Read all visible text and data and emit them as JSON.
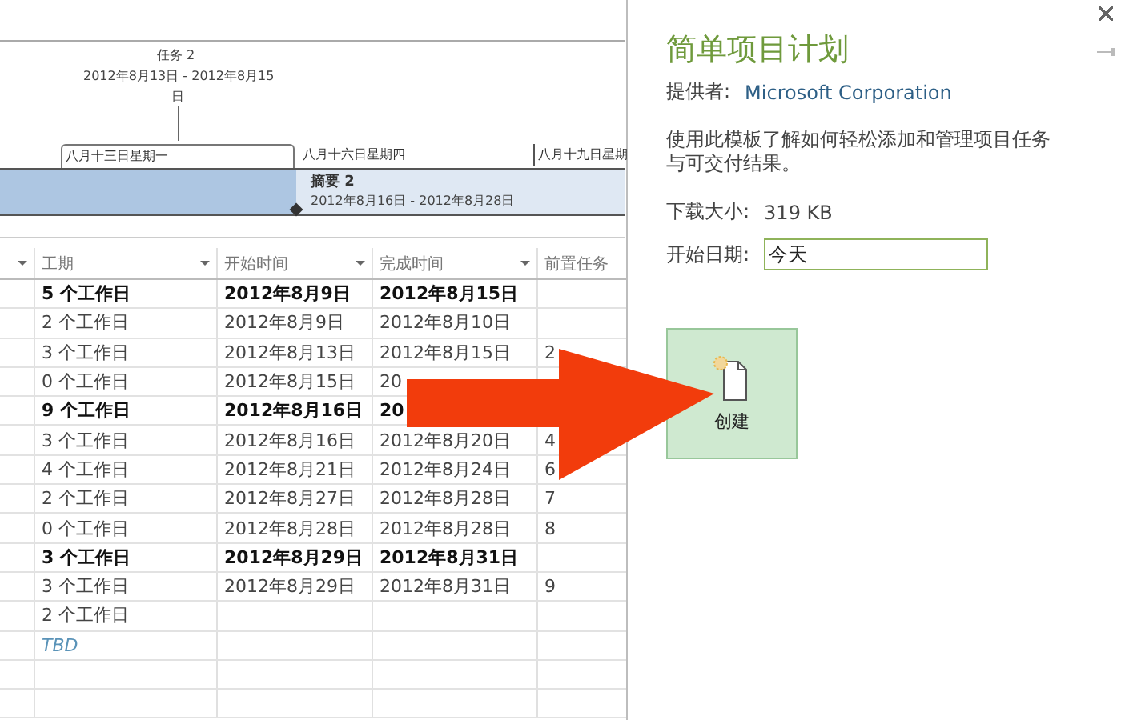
{
  "timeline": {
    "milestone": {
      "name": "任务 2",
      "dates": "2012年8月13日 - 2012年8月15",
      "dates_tail": "日"
    },
    "scale": [
      {
        "label": "八月十三日星期一",
        "kind": "bracket"
      },
      {
        "label": "八月十六日星期四",
        "kind": "plain"
      },
      {
        "label": "八月十九日星期",
        "kind": "tick"
      }
    ],
    "summary": {
      "name": "摘要 2",
      "dates": "2012年8月16日 - 2012年8月28日"
    }
  },
  "table": {
    "columns": [
      "工期",
      "开始时间",
      "完成时间",
      "前置任务"
    ],
    "rows": [
      {
        "kind": "summary",
        "cells": [
          "5 个工作日",
          "2012年8月9日",
          "2012年8月15日"
        ]
      },
      {
        "kind": "task",
        "cells": [
          "2 个工作日",
          "2012年8月9日",
          "2012年8月10日"
        ]
      },
      {
        "kind": "task",
        "cells": [
          "3 个工作日",
          "2012年8月13日",
          "2012年8月15日",
          "2"
        ]
      },
      {
        "kind": "task",
        "cells": [
          "0 个工作日",
          "2012年8月15日",
          "20"
        ]
      },
      {
        "kind": "summary",
        "cells": [
          "9 个工作日",
          "2012年8月16日",
          "20"
        ]
      },
      {
        "kind": "task",
        "cells": [
          "3 个工作日",
          "2012年8月16日",
          "2012年8月20日",
          "4"
        ]
      },
      {
        "kind": "task",
        "cells": [
          "4 个工作日",
          "2012年8月21日",
          "2012年8月24日",
          "6"
        ]
      },
      {
        "kind": "task",
        "cells": [
          "2 个工作日",
          "2012年8月27日",
          "2012年8月28日",
          "7"
        ]
      },
      {
        "kind": "task",
        "cells": [
          "0 个工作日",
          "2012年8月28日",
          "2012年8月28日",
          "8"
        ]
      },
      {
        "kind": "summary",
        "cells": [
          "3 个工作日",
          "2012年8月29日",
          "2012年8月31日"
        ]
      },
      {
        "kind": "task",
        "cells": [
          "3 个工作日",
          "2012年8月29日",
          "2012年8月31日",
          "9"
        ]
      },
      {
        "kind": "task",
        "cells": [
          "2 个工作日"
        ]
      },
      {
        "kind": "tbd",
        "cells": [
          "TBD"
        ]
      }
    ]
  },
  "panel": {
    "title": "简单项目计划",
    "provider_label": "提供者:",
    "provider": "Microsoft Corporation",
    "description": "使用此模板了解如何轻松添加和管理项目任务与可交付结果。",
    "size_label": "下载大小:",
    "size": "319 KB",
    "start_label": "开始日期:",
    "start_value": "今天",
    "create_button": "创建"
  }
}
